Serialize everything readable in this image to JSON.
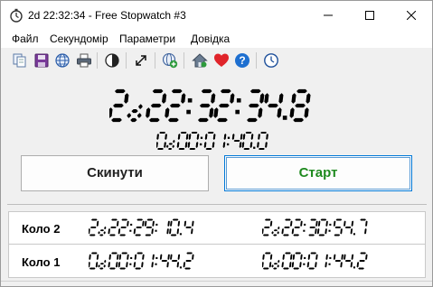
{
  "window": {
    "title": "2d 22:32:34 - Free Stopwatch #3"
  },
  "menu": [
    "Файл",
    "Секундомір",
    "Параметри",
    "Довідка"
  ],
  "toolbar_icons": [
    "copy-icon",
    "save-icon",
    "globe-icon",
    "print-icon",
    "contrast-icon",
    "fullscreen-icon",
    "add-globe-icon",
    "home-icon",
    "heart-icon",
    "help-icon",
    "clock-icon"
  ],
  "display": {
    "main": "2d 22:32:34.8",
    "lap_total": "0d 00:01:40.0"
  },
  "buttons": {
    "reset": "Скинути",
    "start": "Старт"
  },
  "laps": [
    {
      "label": "Коло 2",
      "split": "2d 22:29:10.4",
      "total": "2d 22:30:54.7"
    },
    {
      "label": "Коло 1",
      "split": "0d 00:01:44.2",
      "total": "0d 00:01:44.2"
    }
  ],
  "colors": {
    "start_text": "#1f8a1f",
    "heart": "#e0242a",
    "help": "#1e6fd0",
    "digits": "#000000"
  }
}
